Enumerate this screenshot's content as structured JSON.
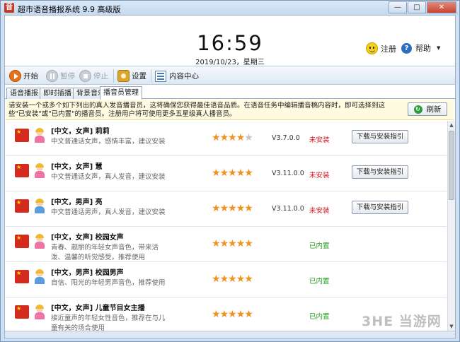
{
  "window": {
    "title": "超市语音播报系统 9.9 高级版",
    "app_icon": "音"
  },
  "winbtns": {
    "minimize": "—",
    "maximize": "□",
    "close": "✕"
  },
  "header": {
    "time": "16:59",
    "date": "2019/10/23，星期三",
    "register_label": "注册",
    "help_label": "帮助",
    "help_icon_glyph": "?",
    "dropdown_glyph": "▼"
  },
  "toolbar": {
    "start_label": "开始",
    "pause_label": "暂停",
    "stop_label": "停止",
    "settings_label": "设置",
    "content_center_label": "内容中心"
  },
  "tabs": [
    {
      "label": "语音播报"
    },
    {
      "label": "即时插播"
    },
    {
      "label": "背景音乐"
    },
    {
      "label": "播音员管理"
    }
  ],
  "notice": {
    "text": "请安装一个或多个如下列出的真人发音播音员，这将确保您获得最佳语音品质。在语音任务中编辑播音稿内容时，即可选择到这些\"已安装\"或\"已内置\"的播音员。注册用户将可使用更多五星级真人播音员。",
    "refresh_label": "刷新",
    "refresh_icon_glyph": "↻"
  },
  "announcers": [
    {
      "name": "[中文，女声] 莉莉",
      "desc": "中文普通话女声，感情丰富，建议安装",
      "rating": 4,
      "version": "V3.7.0.0",
      "status": "未安装",
      "status_color": "red",
      "button": "下载与安装指引",
      "gender": "female"
    },
    {
      "name": "[中文，女声] 慧",
      "desc": "中文普通话女声，真人发音，建议安装",
      "rating": 5,
      "version": "V3.11.0.0",
      "status": "未安装",
      "status_color": "red",
      "button": "下载与安装指引",
      "gender": "female"
    },
    {
      "name": "[中文，男声] 亮",
      "desc": "中文普通话男声，真人发音，建议安装",
      "rating": 5,
      "version": "V3.11.0.0",
      "status": "未安装",
      "status_color": "red",
      "button": "下载与安装指引",
      "gender": "male"
    },
    {
      "name": "[中文，女声] 校园女声",
      "desc": "青春、靓丽的年轻女声音色，带来活泼、温馨的听觉感受，推荐使用",
      "rating": 5,
      "version": "",
      "status": "已内置",
      "status_color": "green",
      "button": "",
      "gender": "female"
    },
    {
      "name": "[中文，男声] 校园男声",
      "desc": "自信、阳光的年轻男声音色，推荐使用",
      "rating": 5,
      "version": "",
      "status": "已内置",
      "status_color": "green",
      "button": "",
      "gender": "male"
    },
    {
      "name": "[中文，女声] 儿童节目女主播",
      "desc": "接近童声的年轻女性音色，推荐在与儿童有关的场合使用",
      "rating": 5,
      "version": "",
      "status": "已内置",
      "status_color": "green",
      "button": "",
      "gender": "female"
    }
  ],
  "scrollbar": {
    "up": "▲",
    "down": "▼"
  },
  "watermark": "3HE 当游网"
}
